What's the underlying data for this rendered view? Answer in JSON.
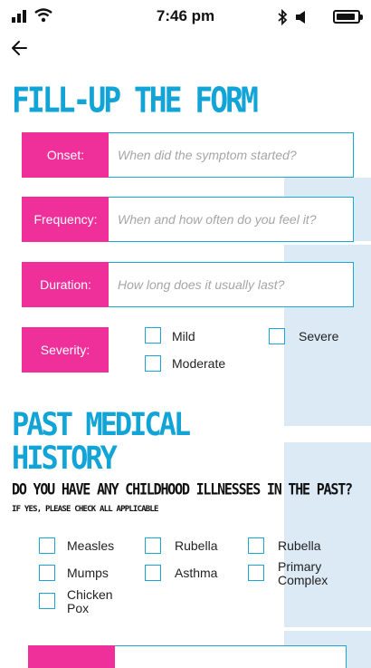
{
  "status_bar": {
    "time": "7:46 pm"
  },
  "page": {
    "title": "FILL-UP THE FORM",
    "section2_title": "PAST MEDICAL HISTORY"
  },
  "form": {
    "onset": {
      "label": "Onset:",
      "placeholder": "When did the symptom started?"
    },
    "frequency": {
      "label": "Frequency:",
      "placeholder": "When and how often do you feel it?"
    },
    "duration": {
      "label": "Duration:",
      "placeholder": "How long does it usually last?"
    },
    "severity": {
      "label": "Severity:",
      "options": [
        "Mild",
        "Severe",
        "Moderate"
      ]
    }
  },
  "history": {
    "question": "DO YOU HAVE ANY CHILDHOOD ILLNESSES IN THE PAST?",
    "hint": "IF YES, PLEASE CHECK ALL APPLICABLE",
    "illnesses": [
      "Measles",
      "Rubella",
      "Rubella",
      "Mumps",
      "Asthma",
      "Primary Complex",
      "Chicken Pox"
    ]
  },
  "colors": {
    "accent_blue": "#12a4d6",
    "accent_pink": "#f0309a",
    "background_stripes": "#dceaf5"
  },
  "icons": [
    "signal-icon",
    "wifi-icon",
    "bluetooth-icon",
    "mute-icon",
    "battery-icon",
    "back-arrow-icon"
  ]
}
